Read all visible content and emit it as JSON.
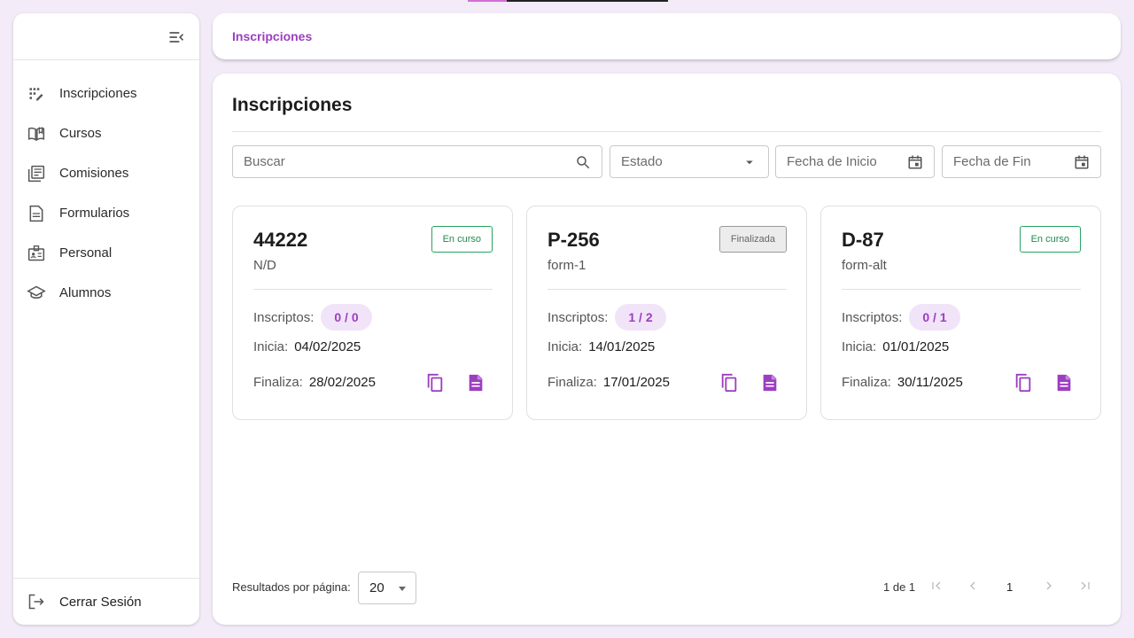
{
  "sidebar": {
    "items": [
      {
        "label": "Inscripciones",
        "icon": "list-edit-icon"
      },
      {
        "label": "Cursos",
        "icon": "book-icon"
      },
      {
        "label": "Comisiones",
        "icon": "library-icon"
      },
      {
        "label": "Formularios",
        "icon": "document-icon"
      },
      {
        "label": "Personal",
        "icon": "badge-icon"
      },
      {
        "label": "Alumnos",
        "icon": "school-icon"
      }
    ],
    "logout": {
      "label": "Cerrar Sesión",
      "icon": "logout-icon"
    }
  },
  "breadcrumb": {
    "current": "Inscripciones"
  },
  "page": {
    "title": "Inscripciones"
  },
  "filters": {
    "search_placeholder": "Buscar",
    "estado_label": "Estado",
    "fecha_inicio_label": "Fecha de Inicio",
    "fecha_fin_label": "Fecha de Fin"
  },
  "labels": {
    "inscriptos": "Inscriptos:",
    "inicia": "Inicia:",
    "finaliza": "Finaliza:"
  },
  "cards": [
    {
      "code": "44222",
      "form": "N/D",
      "status": "En curso",
      "inscriptos": "0 / 0",
      "inicia": "04/02/2025",
      "finaliza": "28/02/2025"
    },
    {
      "code": "P-256",
      "form": "form-1",
      "status": "Finalizada",
      "inscriptos": "1 / 2",
      "inicia": "14/01/2025",
      "finaliza": "17/01/2025"
    },
    {
      "code": "D-87",
      "form": "form-alt",
      "status": "En curso",
      "inscriptos": "0 / 1",
      "inicia": "01/01/2025",
      "finaliza": "30/11/2025"
    }
  ],
  "pagination": {
    "rows_label": "Resultados por página:",
    "rows_value": "20",
    "info": "1 de 1",
    "current_page": "1"
  },
  "colors": {
    "accent": "#9c3ec0",
    "active_status": "#1f8b4d",
    "background": "#f3ebf8"
  }
}
